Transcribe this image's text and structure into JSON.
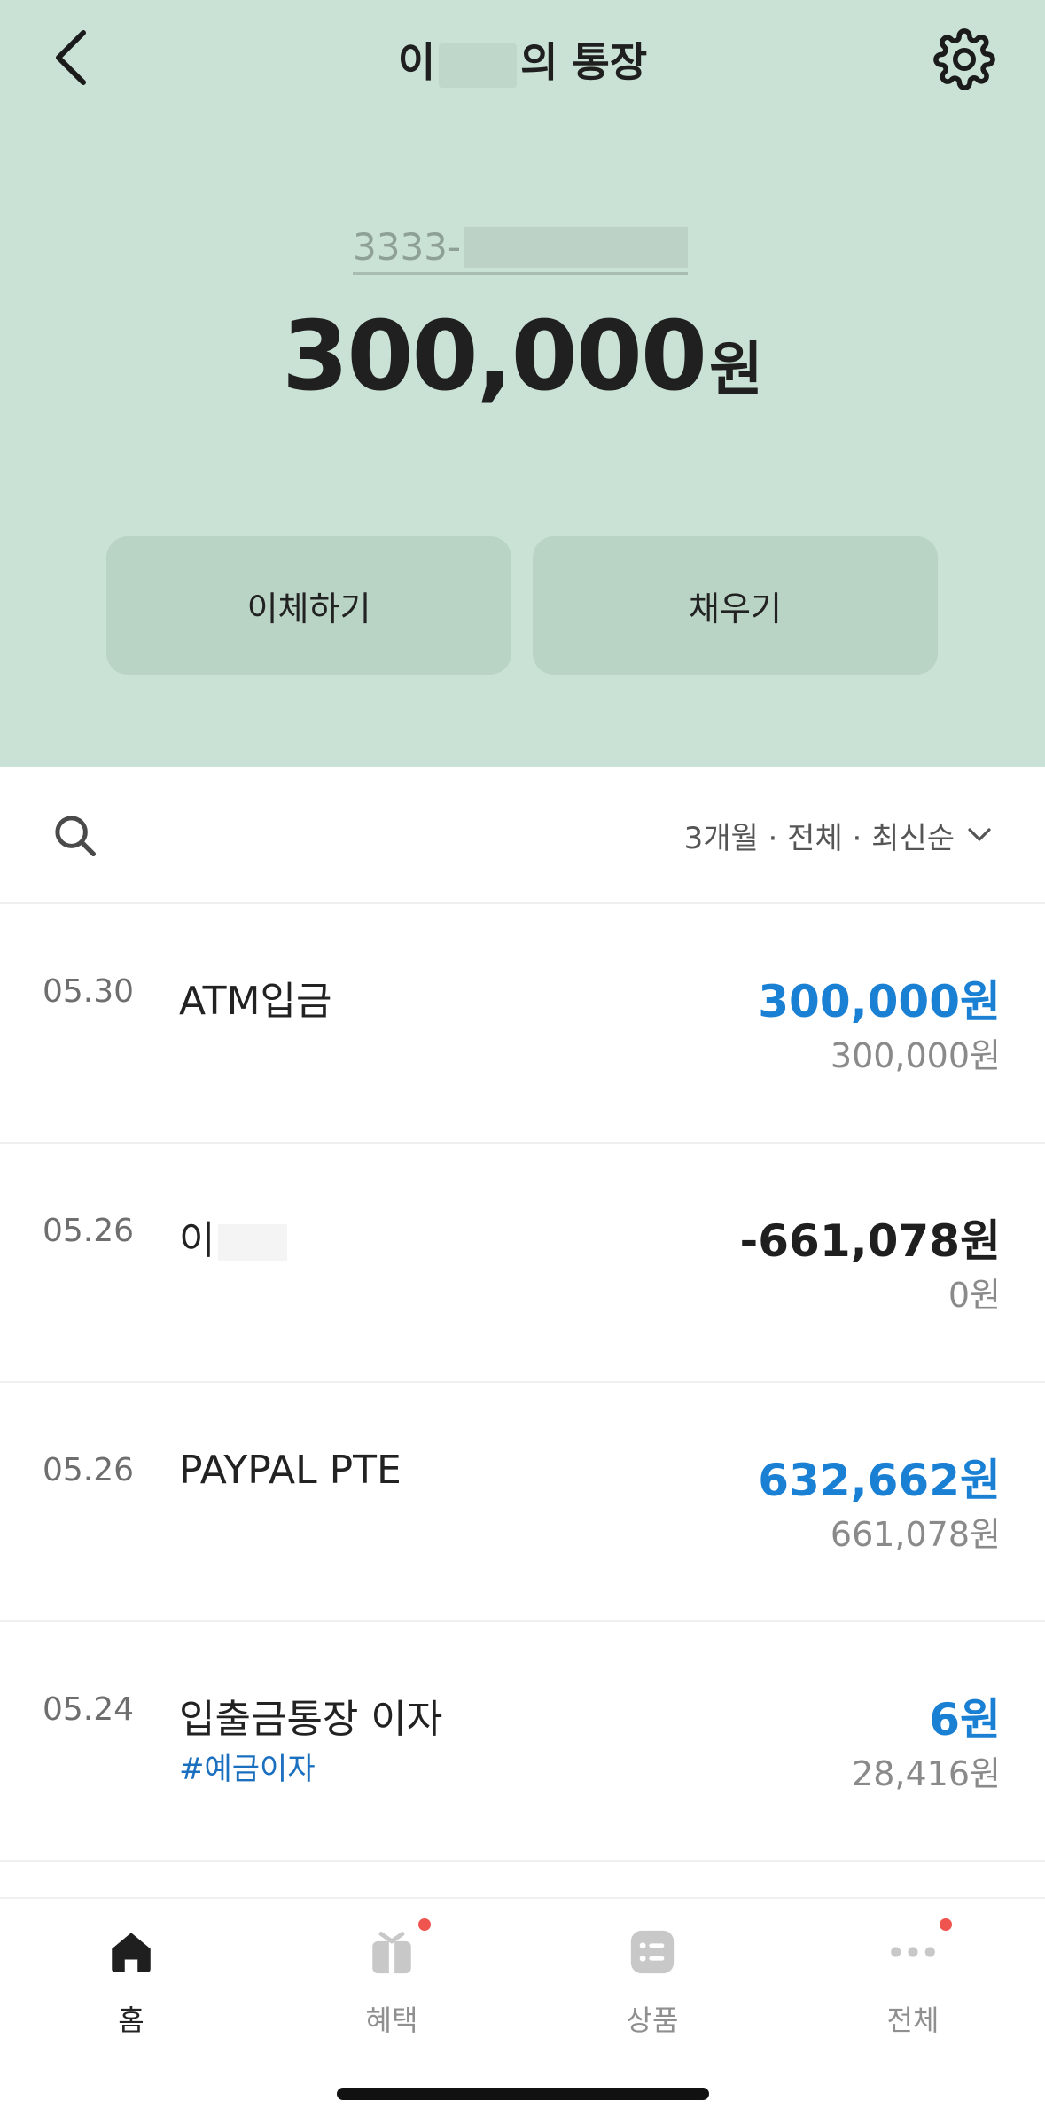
{
  "header": {
    "title_prefix": "이",
    "title_suffix": "의 통장",
    "back_icon": "chevron-left-icon",
    "settings_icon": "gear-icon"
  },
  "account": {
    "number_prefix": "3333-",
    "balance": "300,000",
    "currency_unit": "원"
  },
  "actions": {
    "transfer_label": "이체하기",
    "fill_label": "채우기"
  },
  "filter": {
    "label": "3개월 · 전체 · 최신순",
    "search_icon": "search-icon",
    "dropdown_icon": "chevron-down-icon"
  },
  "transactions": [
    {
      "date": "05.30",
      "name": "ATM입금",
      "tag": "",
      "amount": "300,000원",
      "balance": "300,000원",
      "direction": "in"
    },
    {
      "date": "05.26",
      "name": "이",
      "tag": "",
      "amount": "-661,078원",
      "balance": "0원",
      "direction": "out"
    },
    {
      "date": "05.26",
      "name": "PAYPAL PTE",
      "tag": "",
      "amount": "632,662원",
      "balance": "661,078원",
      "direction": "in"
    },
    {
      "date": "05.24",
      "name": "입출금통장 이자",
      "tag": "#예금이자",
      "amount": "6원",
      "balance": "28,416원",
      "direction": "in"
    }
  ],
  "tabbar": {
    "tabs": [
      {
        "label": "홈",
        "icon": "home-icon",
        "active": true,
        "badge": false
      },
      {
        "label": "혜택",
        "icon": "gift-icon",
        "active": false,
        "badge": true
      },
      {
        "label": "상품",
        "icon": "list-icon",
        "active": false,
        "badge": false
      },
      {
        "label": "전체",
        "icon": "more-icon",
        "active": false,
        "badge": true
      }
    ]
  },
  "colors": {
    "hero_bg": "#c9e2d5",
    "button_bg": "#b9d3c5",
    "deposit_blue": "#1a80d4",
    "badge_red": "#f0544f"
  }
}
